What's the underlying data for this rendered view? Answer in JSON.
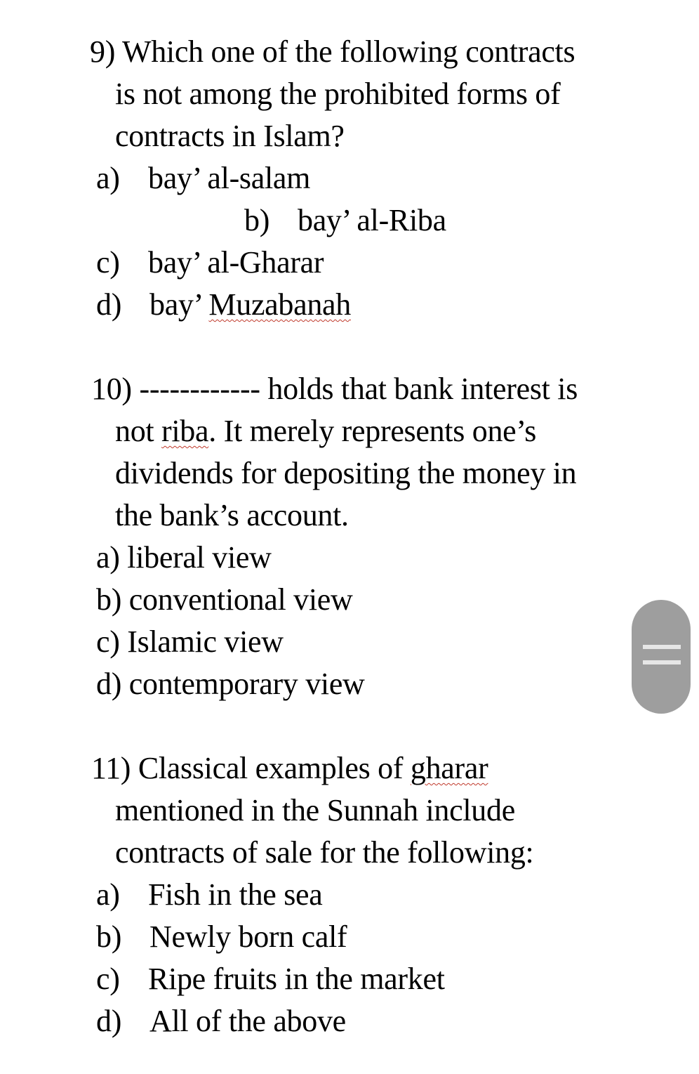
{
  "questions": [
    {
      "number": "9)",
      "stem_lines": [
        "Which one of the following contracts",
        "is not among the prohibited forms of",
        "contracts in Islam?"
      ],
      "options": [
        {
          "letter": "a)",
          "text": "bay’ al-salam"
        },
        {
          "letter": "b)",
          "text": "bay’ al-Riba"
        },
        {
          "letter": "c)",
          "text": "bay’ al-Gharar"
        },
        {
          "letter": "d)",
          "text_prefix": "bay’ ",
          "text_flagged": "Muzabanah"
        }
      ]
    },
    {
      "number": "10)",
      "blank": "------------",
      "stem_lines": [
        "holds that bank interest is",
        "riba",
        ". It merely represents one’s",
        "dividends for depositing the money in",
        "the bank’s account."
      ],
      "stem_line2_prefix": "not ",
      "options": [
        {
          "letter": "a)",
          "text": "liberal view"
        },
        {
          "letter": "b)",
          "text": "conventional view"
        },
        {
          "letter": "c)",
          "text": "Islamic view"
        },
        {
          "letter": "d)",
          "text": "contemporary view"
        }
      ]
    },
    {
      "number": "11)",
      "stem_line1_prefix": "Classical examples of ",
      "stem_line1_flagged": "gharar",
      "stem_lines": [
        "mentioned in the Sunnah include",
        "contracts of sale for the following:"
      ],
      "options": [
        {
          "letter": "a)",
          "text": "Fish in the sea"
        },
        {
          "letter": "b)",
          "text": "Newly born calf"
        },
        {
          "letter": "c)",
          "text": "Ripe fruits in the market"
        },
        {
          "letter": "d)",
          "text": "All of the above"
        }
      ]
    }
  ],
  "scroll_handle": {
    "icon": "drag-handle-icon",
    "color": "#9e9e9e"
  }
}
